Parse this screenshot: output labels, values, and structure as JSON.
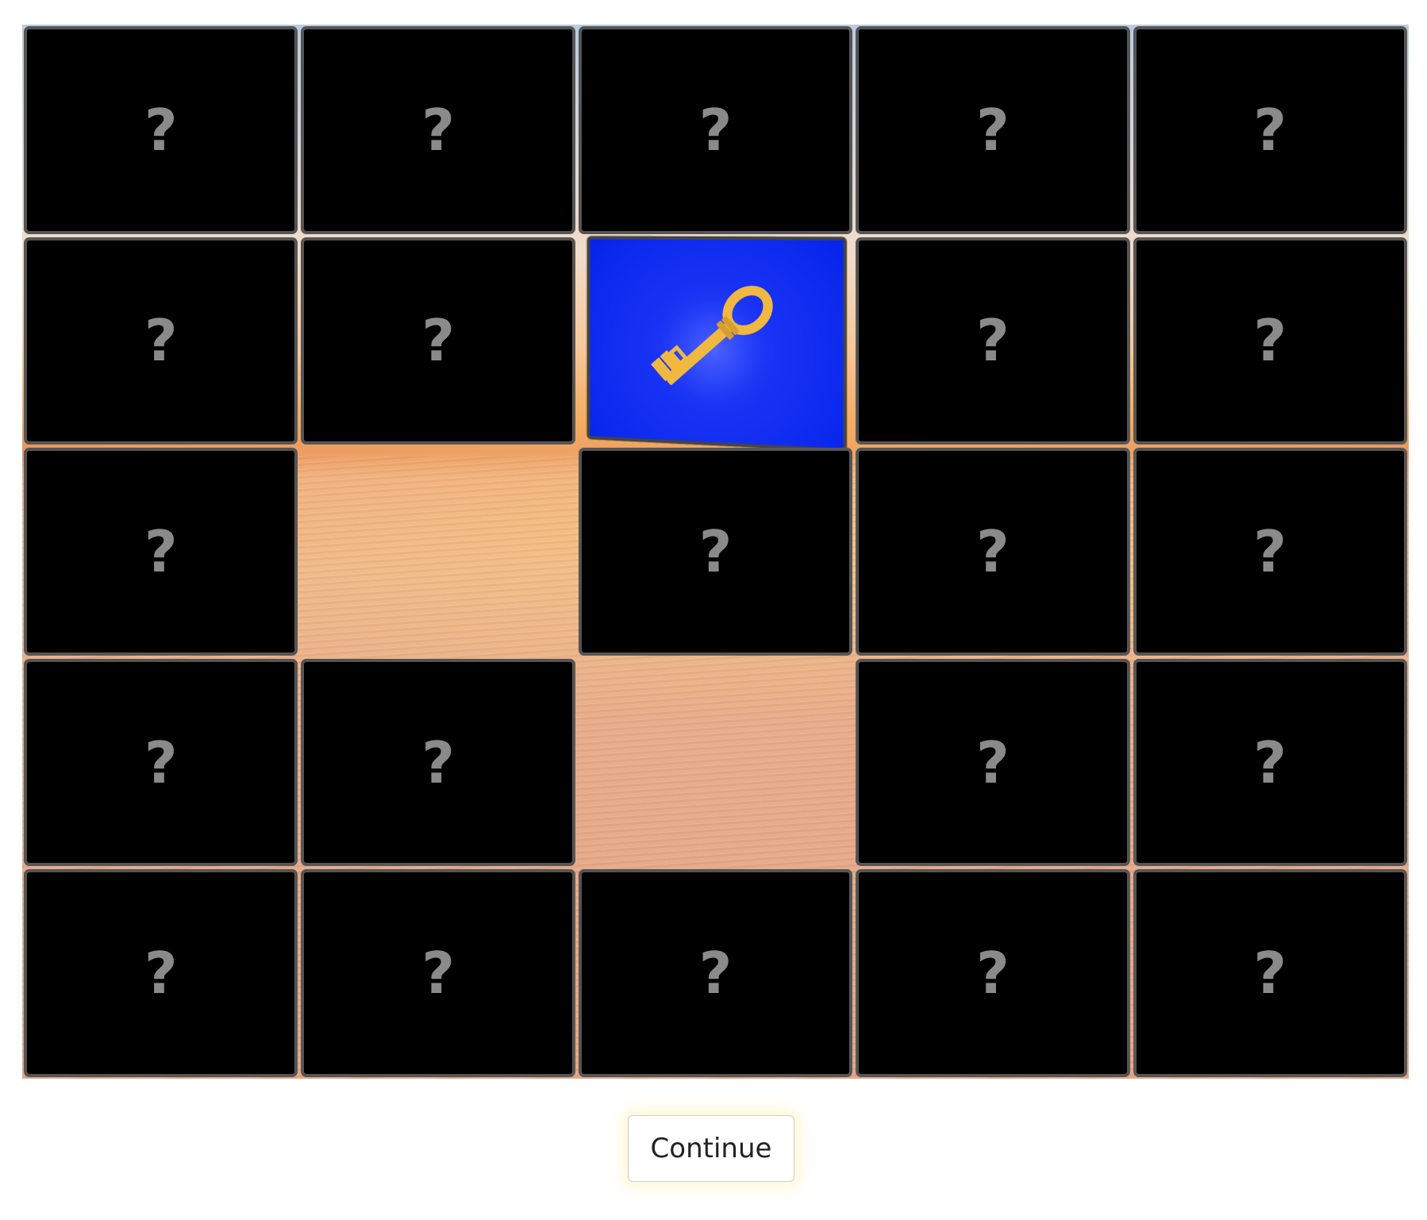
{
  "board": {
    "rows": 5,
    "cols": 5,
    "hidden_symbol": "?",
    "cells": [
      [
        "hidden",
        "hidden",
        "hidden",
        "hidden",
        "hidden"
      ],
      [
        "hidden",
        "hidden",
        "key",
        "hidden",
        "hidden"
      ],
      [
        "hidden",
        "revealed",
        "hidden",
        "hidden",
        "hidden"
      ],
      [
        "hidden",
        "hidden",
        "revealed",
        "hidden",
        "hidden"
      ],
      [
        "hidden",
        "hidden",
        "hidden",
        "hidden",
        "hidden"
      ]
    ],
    "key_card": {
      "icon": "key-icon",
      "card_color": "#0624ea",
      "key_color": "#f0b840"
    },
    "hidden_card_color": "#000000",
    "card_border_color": "#555555",
    "symbol_color": "#8a8a8a"
  },
  "continue_button": {
    "label": "Continue"
  }
}
